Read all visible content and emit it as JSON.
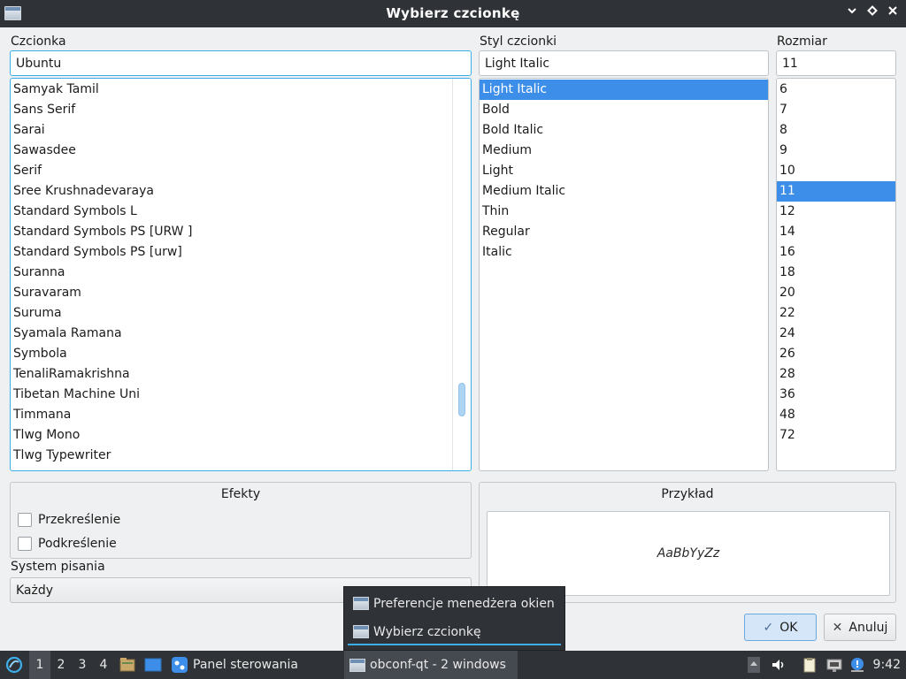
{
  "window": {
    "title": "Wybierz czcionkę"
  },
  "font": {
    "label": "Czcionka",
    "value": "Ubuntu",
    "items": [
      "Samyak Tamil",
      "Sans Serif",
      "Sarai",
      "Sawasdee",
      "Serif",
      "Sree Krushnadevaraya",
      "Standard Symbols L",
      "Standard Symbols PS [URW ]",
      "Standard Symbols PS [urw]",
      "Suranna",
      "Suravaram",
      "Suruma",
      "Syamala Ramana",
      "Symbola",
      "TenaliRamakrishna",
      "Tibetan Machine Uni",
      "Timmana",
      "Tlwg Mono",
      "Tlwg Typewriter"
    ]
  },
  "style": {
    "label": "Styl czcionki",
    "value": "Light Italic",
    "items": [
      "Light Italic",
      "Bold",
      "Bold Italic",
      "Medium",
      "Light",
      "Medium Italic",
      "Thin",
      "Regular",
      "Italic"
    ],
    "selected_index": 0
  },
  "size": {
    "label": "Rozmiar",
    "value": "11",
    "items": [
      "6",
      "7",
      "8",
      "9",
      "10",
      "11",
      "12",
      "14",
      "16",
      "18",
      "20",
      "22",
      "24",
      "26",
      "28",
      "36",
      "48",
      "72"
    ],
    "selected_index": 5
  },
  "effects": {
    "title": "Efekty",
    "strikeout_label": "Przekreślenie",
    "underline_label": "Podkreślenie"
  },
  "writing_system": {
    "label": "System pisania",
    "value": "Każdy"
  },
  "sample": {
    "title": "Przykład",
    "text": "AaBbYyZz"
  },
  "buttons": {
    "ok_label": "OK",
    "cancel_label": "Anuluj"
  },
  "popup": {
    "items": [
      {
        "label": "Preferencje menedżera okien"
      },
      {
        "label": "Wybierz czcionkę"
      }
    ]
  },
  "taskbar": {
    "desktops": [
      "1",
      "2",
      "3",
      "4"
    ],
    "active_desktop": "1",
    "control_panel_label": "Panel sterowania",
    "task_label": "obconf-qt - 2 windows",
    "clock": "9:42"
  },
  "colors": {
    "accent": "#3daee9",
    "selection": "#3d8ee9",
    "panel": "#2f3237"
  }
}
